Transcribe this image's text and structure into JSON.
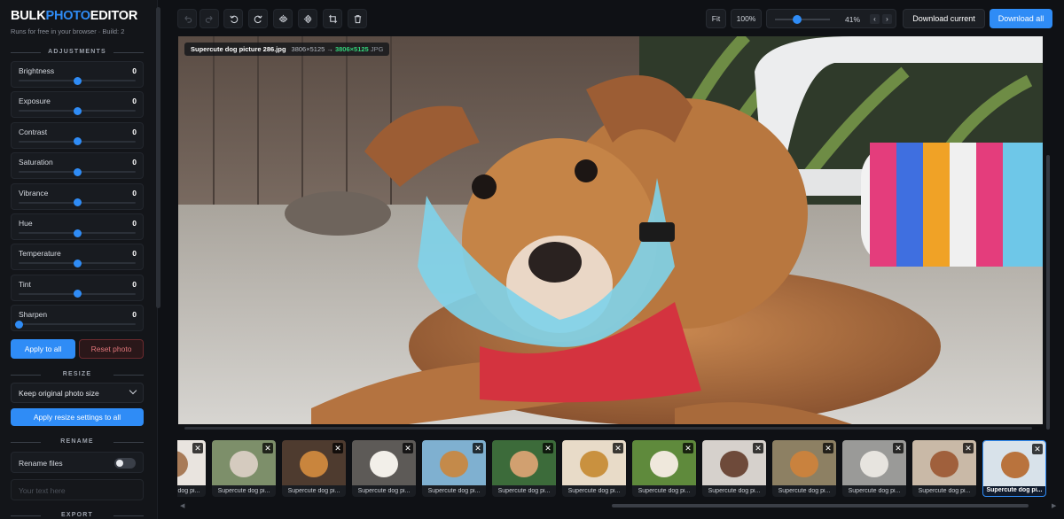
{
  "app": {
    "logo_a": "BULK",
    "logo_b": "PHOTO",
    "logo_c": "EDITOR",
    "tagline": "Runs for free in your browser · Build: 2"
  },
  "sidebar": {
    "adjustments_title": "ADJUSTMENTS",
    "adjustments": [
      {
        "label": "Brightness",
        "value": "0",
        "level": 0.5
      },
      {
        "label": "Exposure",
        "value": "0",
        "level": 0.5
      },
      {
        "label": "Contrast",
        "value": "0",
        "level": 0.5
      },
      {
        "label": "Saturation",
        "value": "0",
        "level": 0.5
      },
      {
        "label": "Vibrance",
        "value": "0",
        "level": 0.5
      },
      {
        "label": "Hue",
        "value": "0",
        "level": 0.5
      },
      {
        "label": "Temperature",
        "value": "0",
        "level": 0.5
      },
      {
        "label": "Tint",
        "value": "0",
        "level": 0.5
      },
      {
        "label": "Sharpen",
        "value": "0",
        "level": 0.0
      }
    ],
    "apply_to_all": "Apply to all",
    "reset_photo": "Reset photo",
    "resize_title": "RESIZE",
    "resize_option": "Keep original photo size",
    "apply_resize": "Apply resize settings to all",
    "rename_title": "RENAME",
    "rename_label": "Rename files",
    "rename_enabled": false,
    "rename_placeholder": "Your text here",
    "export_title": "EXPORT"
  },
  "toolbar": {
    "fit_label": "Fit",
    "zoom_100_label": "100%",
    "zoom_value": "41%",
    "zoom_level": 0.41,
    "download_current": "Download current",
    "download_all": "Download all",
    "icons": [
      "undo-icon",
      "redo-icon",
      "rotate-left-icon",
      "rotate-right-icon",
      "flip-horizontal-icon",
      "flip-vertical-icon",
      "crop-icon",
      "trash-icon"
    ]
  },
  "canvas": {
    "filename": "Supercute dog picture 286.jpg",
    "original_dims": "3806×5125",
    "arrow": "→",
    "new_dims": "3806×5125",
    "format": "JPG"
  },
  "filmstrip": [
    {
      "caption": "Supercute dog pi...",
      "active": false
    },
    {
      "caption": "Supercute dog pi...",
      "active": false
    },
    {
      "caption": "Supercute dog pi...",
      "active": false
    },
    {
      "caption": "Supercute dog pi...",
      "active": false
    },
    {
      "caption": "Supercute dog pi...",
      "active": false
    },
    {
      "caption": "Supercute dog pi...",
      "active": false
    },
    {
      "caption": "Supercute dog pi...",
      "active": false
    },
    {
      "caption": "Supercute dog pi...",
      "active": false
    },
    {
      "caption": "Supercute dog pi...",
      "active": false
    },
    {
      "caption": "Supercute dog pi...",
      "active": false
    },
    {
      "caption": "Supercute dog pi...",
      "active": false
    },
    {
      "caption": "Supercute dog pi...",
      "active": false
    },
    {
      "caption": "Supercute dog pi...",
      "active": true
    }
  ],
  "colors": {
    "accent": "#2f8cf6",
    "background": "#0f1115",
    "danger": "#e0767a",
    "success": "#33d17a"
  }
}
